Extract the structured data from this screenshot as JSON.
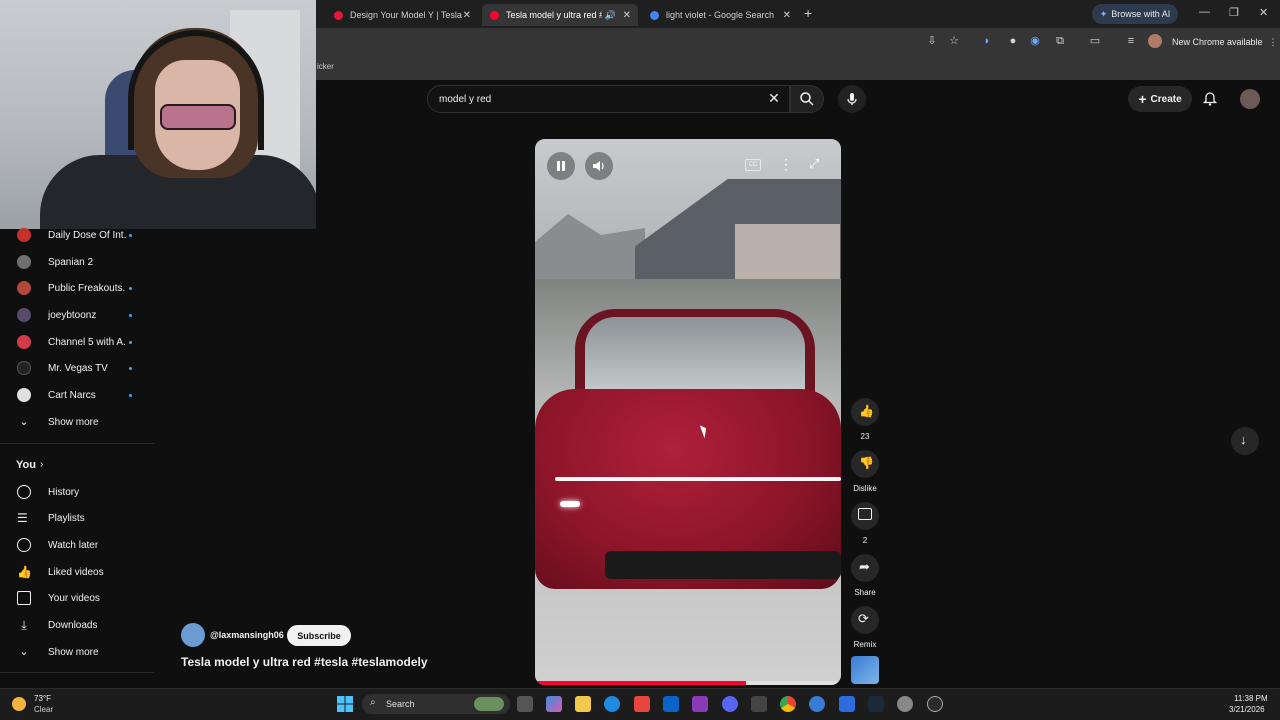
{
  "browser": {
    "tabs": [
      {
        "title": "Design Your Model Y | Tesla",
        "color": "#e31937"
      },
      {
        "title": "Tesla model y ultra red #tesl",
        "color": "#ff0033",
        "active": true
      },
      {
        "title": "light violet - Google Search",
        "color": "#4285f4"
      }
    ],
    "browse_ai": "Browse with AI",
    "update_label": "New Chrome available",
    "bookmark_fragment": "icker"
  },
  "search": {
    "value": "model y red"
  },
  "header": {
    "create_label": "Create"
  },
  "sidebar": {
    "subscriptions": [
      {
        "label": "Daily Dose Of Int...",
        "color": "#c4302b",
        "new": true
      },
      {
        "label": "Spanian 2",
        "color": "#6f6f6f",
        "new": false
      },
      {
        "label": "Public Freakouts...",
        "color": "#b0473a",
        "new": true
      },
      {
        "label": "joeybtoonz",
        "color": "#5a4a6a",
        "new": true
      },
      {
        "label": "Channel 5 with A...",
        "color": "#d23b4a",
        "new": true
      },
      {
        "label": "Mr. Vegas TV",
        "color": "#222222",
        "new": true
      },
      {
        "label": "Cart Narcs",
        "color": "#e0e0e0",
        "new": true
      }
    ],
    "show_more_1": "Show more",
    "you_label": "You",
    "you_items": [
      {
        "label": "History",
        "icon": "history-icon"
      },
      {
        "label": "Playlists",
        "icon": "playlists-icon"
      },
      {
        "label": "Watch later",
        "icon": "clock-icon"
      },
      {
        "label": "Liked videos",
        "icon": "thumbs-up-icon"
      },
      {
        "label": "Your videos",
        "icon": "play-square-icon"
      },
      {
        "label": "Downloads",
        "icon": "download-icon"
      }
    ],
    "show_more_2": "Show more"
  },
  "player": {
    "progress": 0.69,
    "progress_color": "#ff0033"
  },
  "actions": {
    "like_count": "23",
    "dislike_label": "Dislike",
    "comment_count": "2",
    "share_label": "Share",
    "remix_label": "Remix"
  },
  "video": {
    "channel": "@laxmansingh06",
    "subscribe_label": "Subscribe",
    "title": "Tesla model y ultra red #tesla #teslamodely"
  },
  "taskbar": {
    "temp": "73°F",
    "condition": "Clear",
    "search_label": "Search",
    "time": "11:38 PM",
    "date": "3/21/2026"
  }
}
